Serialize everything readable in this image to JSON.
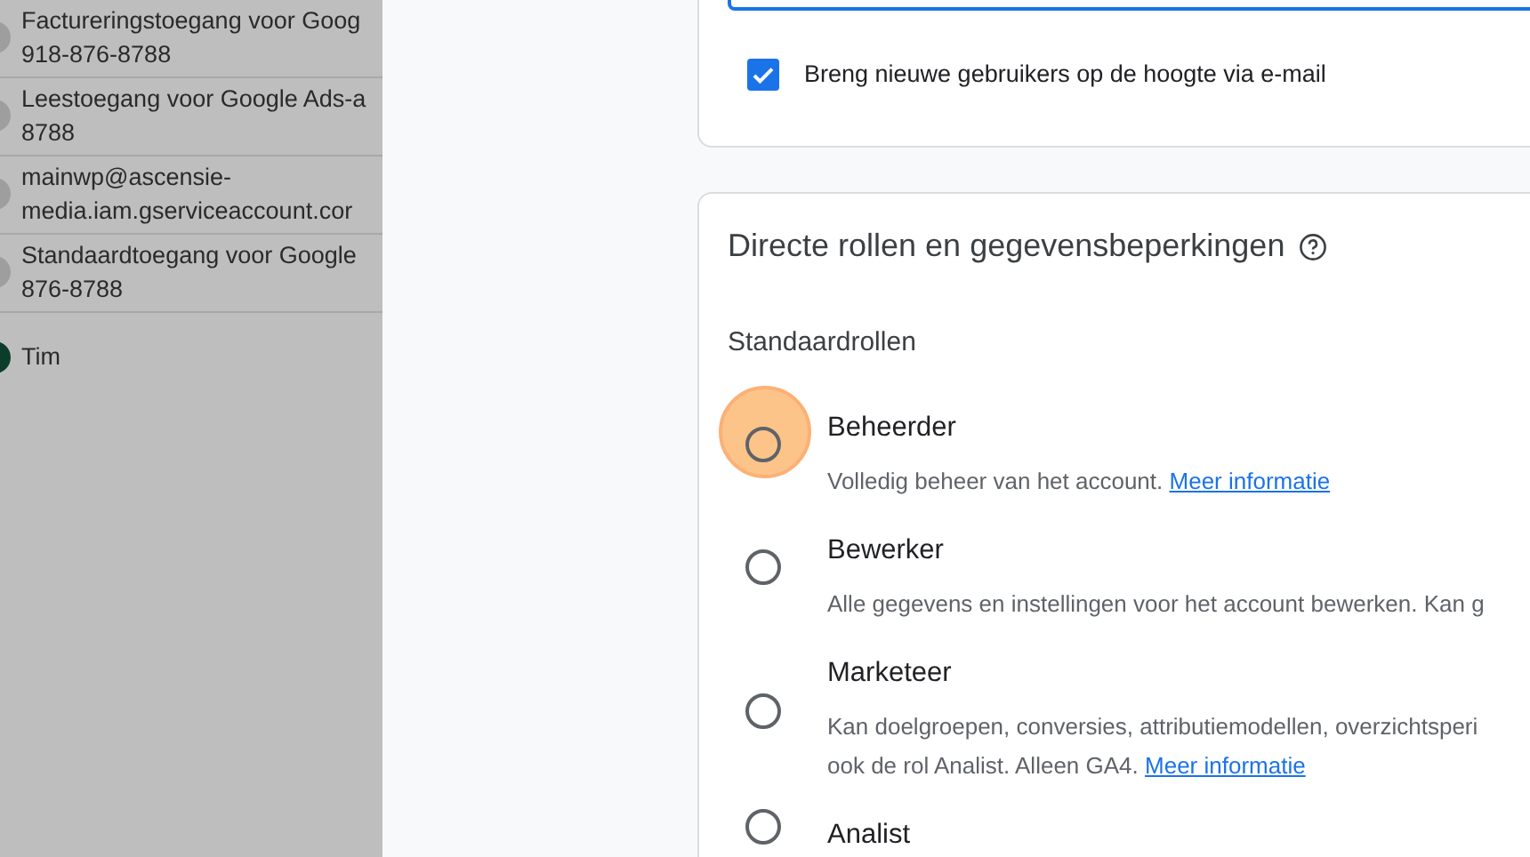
{
  "user_list": [
    {
      "lines": [
        "Factureringstoegang voor Goog",
        "918-876-8788"
      ],
      "color": "#9e9e9e"
    },
    {
      "lines": [
        "Leestoegang voor Google Ads-a",
        "8788"
      ],
      "color": "#9e9e9e"
    },
    {
      "lines": [
        "mainwp@ascensie-",
        "media.iam.gserviceaccount.cor"
      ],
      "color": "#9e9e9e"
    },
    {
      "lines": [
        "Standaardtoegang voor Google",
        "876-8788"
      ],
      "color": "#9e9e9e"
    },
    {
      "lines": [
        "Tim"
      ],
      "color": "#0b3d2a"
    }
  ],
  "notify": {
    "label": "Breng nieuwe gebruikers op de hoogte via e-mail",
    "checked": true
  },
  "roles_card": {
    "title": "Directe rollen en gegevensbeperkingen",
    "section": "Standaardrollen",
    "roles": [
      {
        "name": "Beheerder",
        "selected": false,
        "highlighted": true,
        "description": [
          "Volledig beheer van het account."
        ],
        "link": "Meer informatie"
      },
      {
        "name": "Bewerker",
        "selected": false,
        "highlighted": false,
        "description": [
          "Alle gegevens en instellingen voor het account bewerken. Kan g"
        ]
      },
      {
        "name": "Marketeer",
        "selected": false,
        "highlighted": false,
        "description": [
          "Kan doelgroepen, conversies, attributiemodellen, overzichtsperi",
          "ook de rol Analist. Alleen GA4."
        ],
        "link": "Meer informatie"
      },
      {
        "name": "Analist",
        "selected": false,
        "highlighted": false
      }
    ]
  }
}
